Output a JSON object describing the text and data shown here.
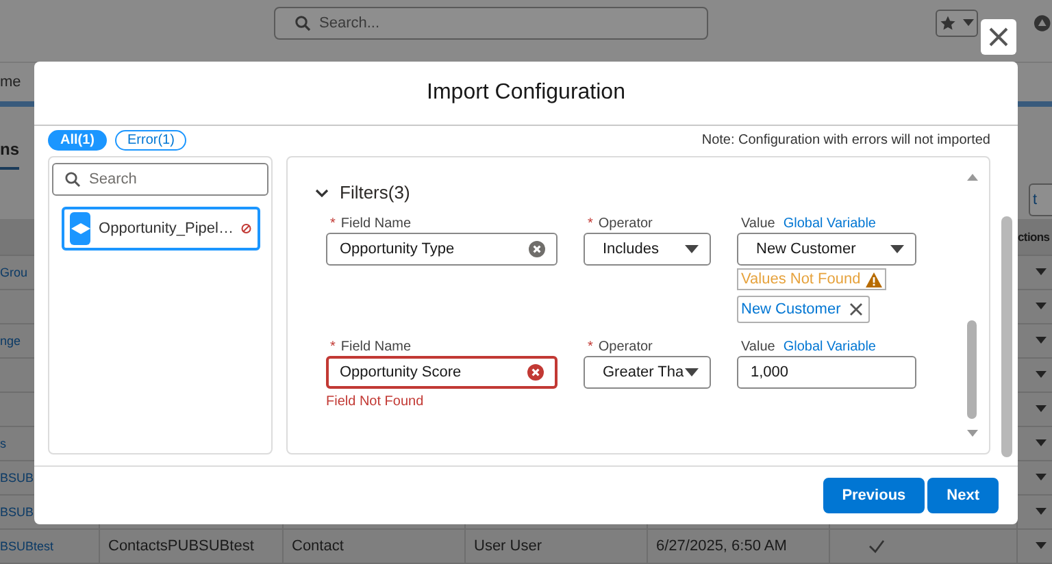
{
  "app": {
    "search_placeholder": "Search...",
    "nav_tab": "me",
    "page_tab": "ns",
    "side_button": "t",
    "table": {
      "last_header": "ctions",
      "rows": [
        {
          "cells": [
            "Grou"
          ],
          "check": false
        },
        {
          "cells": [],
          "check": false
        },
        {
          "cells": [
            "nge"
          ],
          "check": false
        },
        {
          "cells": [],
          "check": false
        },
        {
          "cells": [],
          "check": false
        },
        {
          "cells": [
            "s"
          ],
          "check": false
        },
        {
          "cells": [
            "BSUB"
          ],
          "check": false
        },
        {
          "cells": [
            "BSUB"
          ],
          "check": false
        },
        {
          "cells": [
            "BSUBtest",
            "ContactsPUBSUBtest",
            "Contact",
            "User User",
            "6/27/2025, 6:50 AM"
          ],
          "check": true
        }
      ]
    }
  },
  "modal": {
    "title": "Import Configuration",
    "chips": [
      {
        "label": "All(1)",
        "selected": true
      },
      {
        "label": "Error(1)",
        "selected": false
      }
    ],
    "note": "Note: Configuration with errors will not imported",
    "list": {
      "placeholder": "Search",
      "items": [
        {
          "name": "Opportunity_Pipel…",
          "selected": true,
          "error": true
        }
      ]
    },
    "filters": {
      "title": "Filters(3)",
      "expanded": true,
      "rows": [
        {
          "field": {
            "label": "Field Name",
            "mark": "*",
            "value": "Opportunity Type",
            "error": false
          },
          "operator": {
            "label": "Operator",
            "mark": "*",
            "value": "Includes"
          },
          "value": {
            "label": "Value",
            "link": "Global Variable",
            "kind": "dropdown",
            "value": "New Customer",
            "warning": "Values Not Found",
            "pills": [
              "New Customer"
            ]
          }
        },
        {
          "field": {
            "label": "Field Name",
            "mark": "*",
            "value": "Opportunity Score",
            "error": true,
            "message": "Field Not Found"
          },
          "operator": {
            "label": "Operator",
            "mark": "*",
            "value": "Greater Tha"
          },
          "value": {
            "label": "Value",
            "link": "Global Variable",
            "kind": "text",
            "value": "1,000"
          }
        }
      ]
    },
    "buttons": [
      {
        "label": "Previous"
      },
      {
        "label": "Next"
      }
    ]
  }
}
